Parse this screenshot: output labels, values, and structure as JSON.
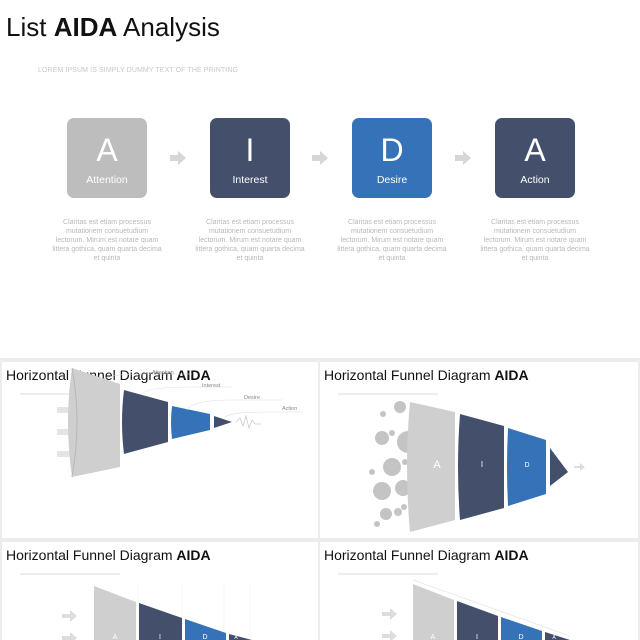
{
  "main": {
    "title_prefix": "List ",
    "title_bold": "AIDA",
    "title_suffix": " Analysis",
    "subtitle": "LOREM IPSUM IS SIMPLY DUMMY TEXT  OF THE PRINTING",
    "steps": [
      {
        "letter": "A",
        "label": "Attention",
        "color": "#bdbdbd",
        "desc": "Claritas est etiam processus mutationem consuetudium lectorum. Mirum est notare quam littera gothica, quam quarta decima et quinta"
      },
      {
        "letter": "I",
        "label": "Interest",
        "color": "#44506b",
        "desc": "Claritas est etiam processus mutationem consuetudium lectorum. Mirum est notare quam littera gothica, quam quarta decima et quinta"
      },
      {
        "letter": "D",
        "label": "Desire",
        "color": "#3572b8",
        "desc": "Claritas est etiam processus mutationem consuetudium lectorum. Mirum est notare quam littera gothica, quam quarta decima et quinta"
      },
      {
        "letter": "A",
        "label": "Action",
        "color": "#44506b",
        "desc": "Claritas est etiam processus mutationem consuetudium lectorum. Mirum est notare quam littera gothica, quam quarta decima et quinta"
      }
    ],
    "arrow_icon": "arrow-right-icon"
  },
  "panels": [
    {
      "title": "Horizontal Funnel Diagram ",
      "bold": "AIDA",
      "labels": [
        "Attention",
        "Interest",
        "Desire",
        "Action"
      ]
    },
    {
      "title": "Horizontal Funnel Diagram ",
      "bold": "AIDA",
      "letters": [
        "A",
        "I",
        "D"
      ]
    },
    {
      "title": "Horizontal Funnel Diagram ",
      "bold": "AIDA",
      "letters": [
        "A",
        "I",
        "D",
        "A"
      ]
    },
    {
      "title": "Horizontal Funnel Diagram ",
      "bold": "AIDA",
      "letters": [
        "A",
        "I",
        "D",
        "A"
      ]
    }
  ]
}
